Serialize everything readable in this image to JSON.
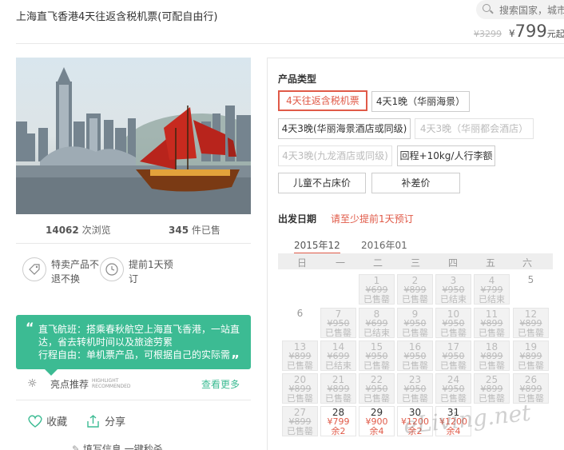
{
  "header": {
    "title": "上海直飞香港4天往返含税机票(可配自由行)",
    "search_placeholder": "搜索国家，城市",
    "price_old": "¥3299",
    "price_yen": "¥",
    "price_current": "799",
    "price_unit": "元起"
  },
  "stats": {
    "views_num": "14062",
    "views_label": "次浏览",
    "sold_num": "345",
    "sold_label": "件已售"
  },
  "features": [
    {
      "icon": "tag-icon",
      "text": "特卖产品不退不换"
    },
    {
      "icon": "clock-icon",
      "text": "提前1天预订"
    }
  ],
  "note": {
    "open_quote": "“",
    "text": "直飞航班：搭乘春秋航空上海直飞香港，一站直达，省去转机时间以及旅途劳累\n行程自由：单机票产品，可根据自己的实际需",
    "close_quote": "„"
  },
  "highlight": {
    "label": "亮点推荐",
    "en1": "HIGHLIGHT",
    "en2": "RECOMMENDED",
    "more": "查看更多"
  },
  "actions": {
    "favorite": "收藏",
    "share": "分享",
    "fill": "填写信息 一键秒杀"
  },
  "product_types": {
    "title": "产品类型",
    "options": [
      {
        "label": "4天往返含税机票",
        "state": "selected"
      },
      {
        "label": "4天1晚（华丽海景）",
        "state": "normal"
      },
      {
        "label": "4天3晚(华丽海景酒店或同级)",
        "state": "normal"
      },
      {
        "label": "4天3晚（华丽都会酒店）",
        "state": "disabled"
      },
      {
        "label": "4天3晚(九龙酒店或同级)",
        "state": "disabled"
      },
      {
        "label": "回程+10kg/人行李额",
        "state": "normal"
      },
      {
        "label": "儿童不占床价",
        "state": "normal"
      },
      {
        "label": "补差价",
        "state": "normal"
      }
    ]
  },
  "departure": {
    "title": "出发日期",
    "notice": "请至少提前1天预订",
    "months": [
      "2015年12",
      "2016年01"
    ],
    "weekdays": [
      "日",
      "一",
      "二",
      "三",
      "四",
      "五",
      "六"
    ],
    "cells": [
      {
        "day": "1",
        "price": "¥699",
        "status": "已售罄",
        "avail": false
      },
      {
        "day": "2",
        "price": "¥899",
        "status": "已售罄",
        "avail": false
      },
      {
        "day": "3",
        "price": "¥950",
        "status": "已结束",
        "avail": false
      },
      {
        "day": "4",
        "price": "¥799",
        "status": "已结束",
        "avail": false
      },
      {
        "day": "5",
        "price": "",
        "status": "",
        "avail": false,
        "plain": true
      },
      {
        "day": "6",
        "price": "",
        "status": "",
        "avail": false,
        "plain": true
      },
      {
        "day": "7",
        "price": "¥950",
        "status": "已售罄",
        "avail": false
      },
      {
        "day": "8",
        "price": "¥699",
        "status": "已结束",
        "avail": false
      },
      {
        "day": "9",
        "price": "¥950",
        "status": "已售罄",
        "avail": false
      },
      {
        "day": "10",
        "price": "¥950",
        "status": "已售罄",
        "avail": false
      },
      {
        "day": "11",
        "price": "¥899",
        "status": "已售罄",
        "avail": false
      },
      {
        "day": "12",
        "price": "¥899",
        "status": "已售罄",
        "avail": false
      },
      {
        "day": "13",
        "price": "¥899",
        "status": "已售罄",
        "avail": false
      },
      {
        "day": "14",
        "price": "¥699",
        "status": "已结束",
        "avail": false
      },
      {
        "day": "15",
        "price": "¥950",
        "status": "已售罄",
        "avail": false
      },
      {
        "day": "16",
        "price": "¥950",
        "status": "已售罄",
        "avail": false
      },
      {
        "day": "17",
        "price": "¥950",
        "status": "已售罄",
        "avail": false
      },
      {
        "day": "18",
        "price": "¥899",
        "status": "已售罄",
        "avail": false
      },
      {
        "day": "19",
        "price": "¥899",
        "status": "已售罄",
        "avail": false
      },
      {
        "day": "20",
        "price": "¥899",
        "status": "已售罄",
        "avail": false
      },
      {
        "day": "21",
        "price": "¥899",
        "status": "已售罄",
        "avail": false
      },
      {
        "day": "22",
        "price": "¥950",
        "status": "已售罄",
        "avail": false
      },
      {
        "day": "23",
        "price": "¥950",
        "status": "已售罄",
        "avail": false
      },
      {
        "day": "24",
        "price": "¥950",
        "status": "已售罄",
        "avail": false
      },
      {
        "day": "25",
        "price": "¥899",
        "status": "已售罄",
        "avail": false
      },
      {
        "day": "26",
        "price": "¥899",
        "status": "已售罄",
        "avail": false
      },
      {
        "day": "27",
        "price": "¥899",
        "status": "已售罄",
        "avail": false
      },
      {
        "day": "28",
        "price": "¥799",
        "status": "余2",
        "avail": true
      },
      {
        "day": "29",
        "price": "¥900",
        "status": "余4",
        "avail": true
      },
      {
        "day": "30",
        "price": "¥1200",
        "status": "余2",
        "avail": true
      },
      {
        "day": "31",
        "price": "¥1200",
        "status": "余4",
        "avail": true
      }
    ]
  },
  "watermark": "eLiving.net",
  "colors": {
    "accent_red": "#e05a48",
    "accent_green": "#3cbb93"
  }
}
